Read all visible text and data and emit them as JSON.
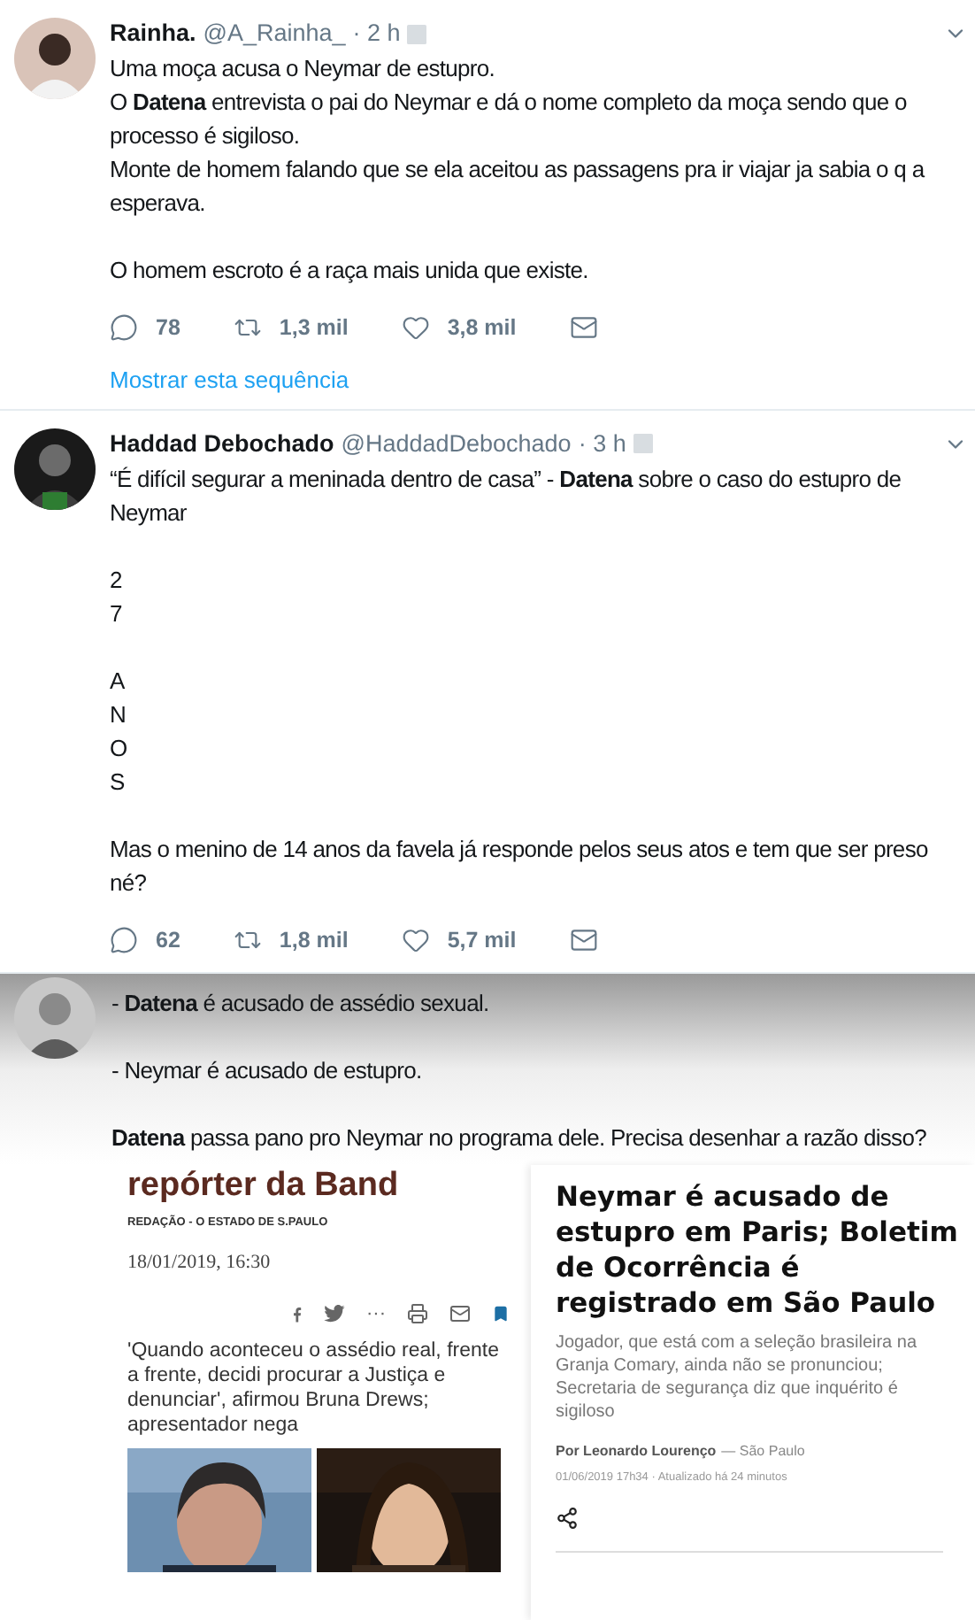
{
  "tweets": [
    {
      "name": "Rainha.",
      "handle": "@A_Rainha_",
      "time": "· 2 h",
      "body": [
        [
          "Uma moça acusa o Neymar de estupro.",
          "O **Datena** entrevista o pai do Neymar e dá o nome completo da moça sendo que o processo é sigiloso.",
          "Monte de homem falando que se ela aceitou as passagens pra ir viajar ja sabia o q a esperava."
        ],
        [
          "O homem escroto é a raça mais unida que existe."
        ]
      ],
      "replies": "78",
      "retweets": "1,3 mil",
      "likes": "3,8 mil",
      "thread_link": "Mostrar esta sequência"
    },
    {
      "name": "Haddad Debochado",
      "handle": "@HaddadDebochado",
      "time": "· 3 h",
      "body": [
        [
          "“É difícil segurar a meninada dentro de casa” - **Datena** sobre o caso do estupro de Neymar"
        ],
        [
          "2",
          "7"
        ],
        [
          "A",
          "N",
          "O",
          "S"
        ],
        [
          "Mas o menino de 14 anos da favela já responde pelos seus atos e tem que ser preso né?"
        ]
      ],
      "replies": "62",
      "retweets": "1,8 mil",
      "likes": "5,7 mil"
    }
  ],
  "quoted_tweet": {
    "body": [
      [
        "- **Datena** é acusado de assédio sexual."
      ],
      [
        "- Neymar é acusado de estupro."
      ],
      [
        "**Datena** passa pano pro Neymar no programa dele. Precisa desenhar a razão disso?"
      ]
    ]
  },
  "article_left": {
    "headline": "repórter da Band",
    "byline": "REDAÇÃO - O ESTADO DE S.PAULO",
    "date": "18/01/2019, 16:30",
    "subtitle": "'Quando aconteceu o assédio real, frente a frente, decidi procurar a Justiça e denunciar', afirmou Bruna Drews; apresentador nega",
    "share_dots": "···"
  },
  "article_right": {
    "headline": "Neymar é acusado de estupro em Paris; Boletim de Ocorrência é registrado em São Paulo",
    "subtitle": "Jogador, que está com a seleção brasileira na Granja Comary, ainda não se pronunciou; Secretaria de segurança diz que inquérito é sigiloso",
    "author": "Por Leonardo Lourenço",
    "place": "— São Paulo",
    "date": "01/06/2019 17h34 · Atualizado há 24 minutos"
  }
}
